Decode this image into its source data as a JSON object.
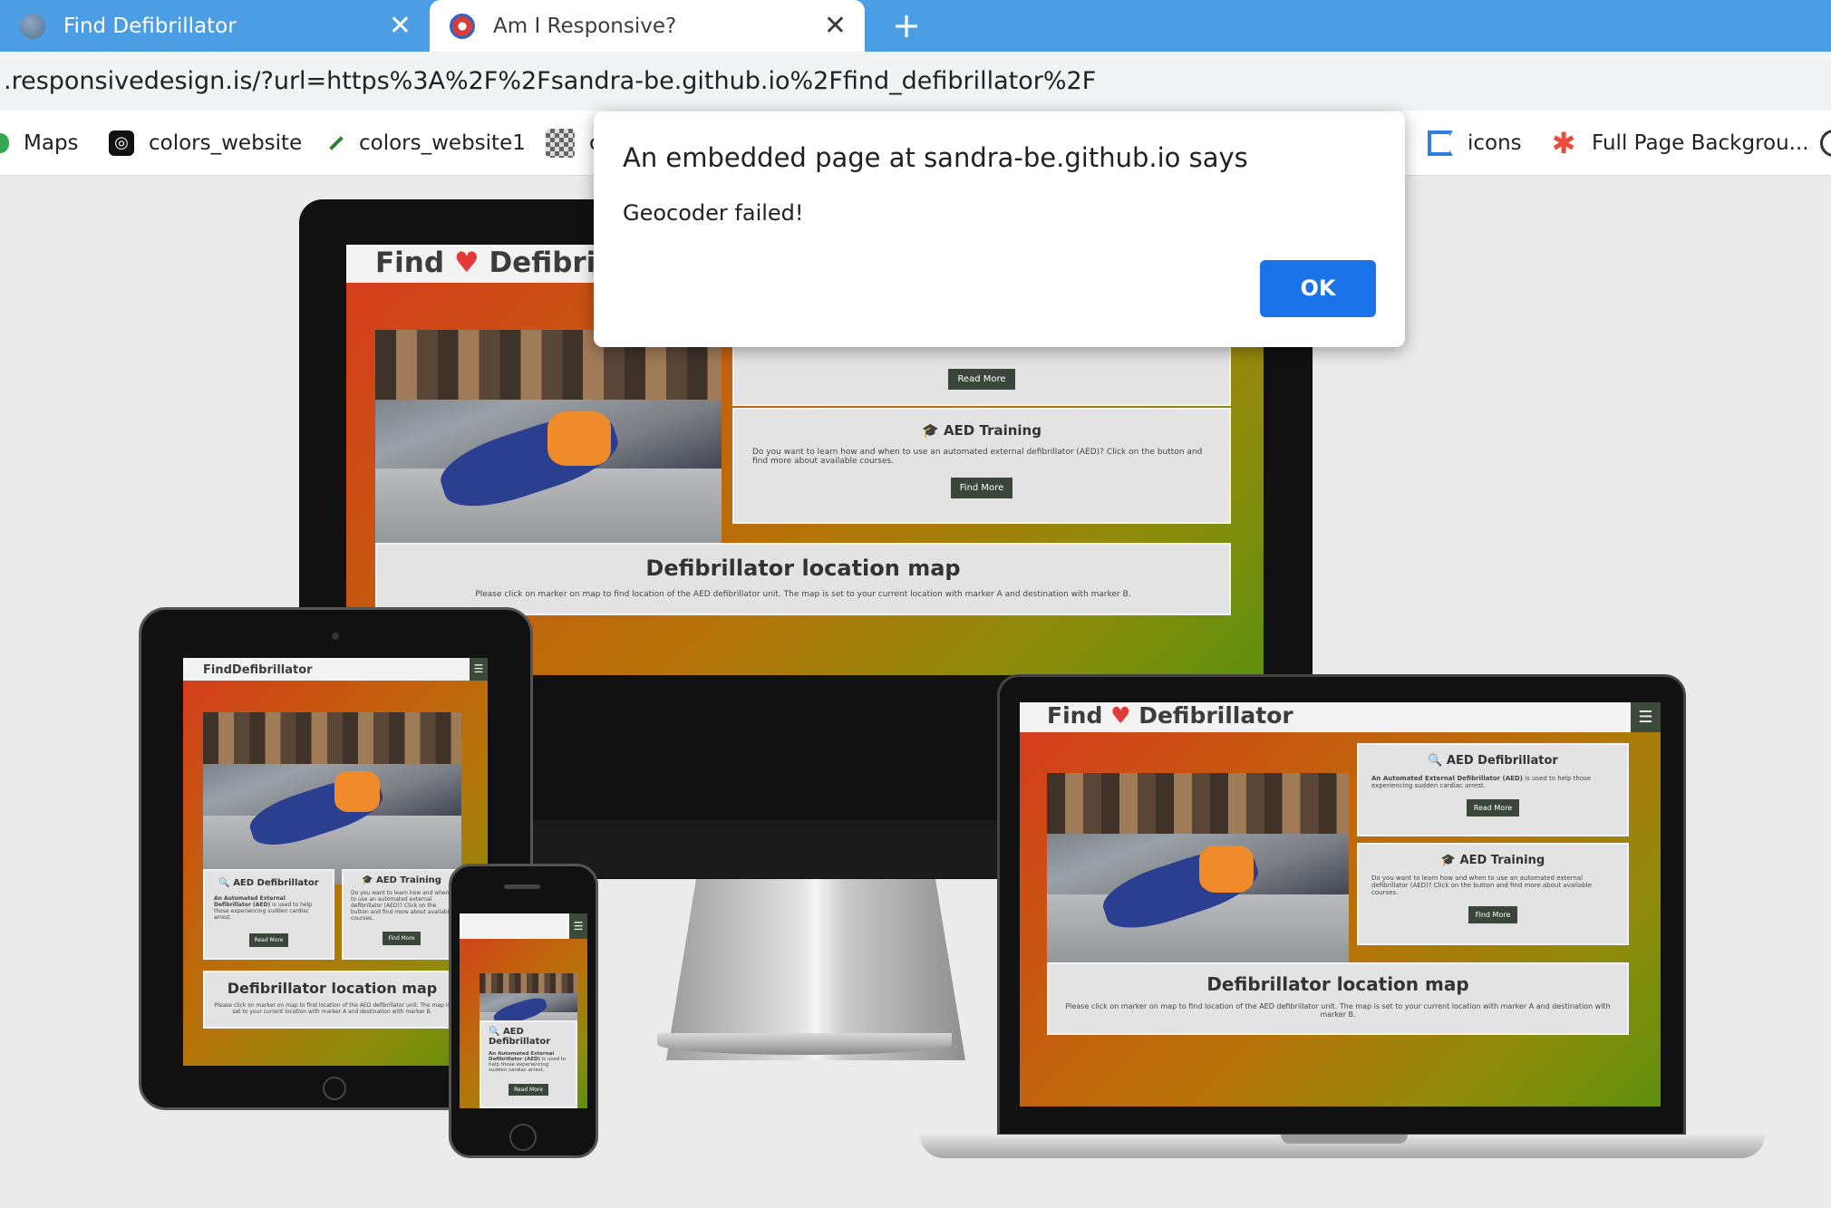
{
  "tabs": [
    {
      "title": "Find Defibrillator",
      "icon": "globe-icon",
      "active": false
    },
    {
      "title": "Am I Responsive?",
      "icon": "am-i-responsive-icon",
      "active": true
    }
  ],
  "new_tab": "+",
  "address": {
    "url": ".responsivedesign.is/?url=https%3A%2F%2Fsandra-be.github.io%2Ffind_defibrillator%2F"
  },
  "bookmarks": [
    {
      "label": "Maps",
      "icon": "maps-icon"
    },
    {
      "label": "colors_website",
      "icon": "colors-icon"
    },
    {
      "label": "colors_website1",
      "icon": "pen-icon"
    },
    {
      "label": "c",
      "icon": "grid-icon"
    },
    {
      "label": "icons",
      "icon": "flag-icon"
    },
    {
      "label": "Full Page Backgrou...",
      "icon": "asterisk-icon"
    }
  ],
  "dialog": {
    "title": "An embedded page at sandra-be.github.io says",
    "message": "Geocoder failed!",
    "ok_label": "OK",
    "ok_color": "#1a73e8"
  },
  "site": {
    "brand_find": "Find",
    "brand_defib": "Defibrillator",
    "brand_compact": "FindDefibrillator",
    "card1_title": "AED Defibrillator",
    "card1_title_split": [
      "AED",
      "Defibrillator"
    ],
    "card1_bold": "An Automated External Defibrillator (AED)",
    "card1_text": " is used to help those experiencing sudden cardiac arrest.",
    "card1_button": "Read More",
    "card2_title": "AED Training",
    "card2_text": "Do you want to learn how and when to use an automated external defibrillator (AED)? Click on the button and find more about available courses.",
    "card2_button": "Find More",
    "map_title": "Defibrillator location map",
    "map_text": "Please click on marker on map to find location of the AED defibrillator unit. The map is set to your current location with marker A and destination with marker B."
  },
  "colors": {
    "tabbar": "#4b9de4",
    "header_button": "#3b463b",
    "heart": "#e23a3a"
  }
}
